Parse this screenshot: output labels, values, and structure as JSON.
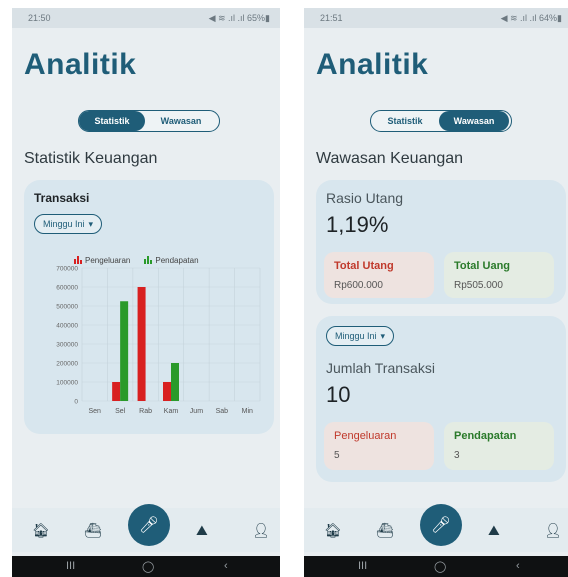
{
  "left": {
    "status": {
      "time": "21:50",
      "icons": "◀ ≋ .ıl .ıl 65%▮"
    },
    "title": "Analitik",
    "tabs": [
      {
        "label": "Statistik",
        "active": true
      },
      {
        "label": "Wawasan",
        "active": false
      }
    ],
    "section_title": "Statistik Keuangan",
    "card": {
      "title": "Transaksi",
      "dropdown": "Minggu Ini"
    },
    "legend": {
      "expense": "Pengeluaran",
      "income": "Pendapatan"
    },
    "chart_data": {
      "type": "bar",
      "categories": [
        "Sen",
        "Sel",
        "Rab",
        "Kam",
        "Jum",
        "Sab",
        "Min"
      ],
      "series": [
        {
          "name": "Pengeluaran",
          "color": "#d82020",
          "values": [
            0,
            100000,
            600000,
            100000,
            0,
            0,
            0
          ]
        },
        {
          "name": "Pendapatan",
          "color": "#2a9a2a",
          "values": [
            0,
            525000,
            0,
            200000,
            0,
            0,
            0
          ]
        }
      ],
      "ylim": [
        0,
        700000
      ],
      "yticks": [
        0,
        100000,
        200000,
        300000,
        400000,
        500000,
        600000,
        700000
      ],
      "grid": true,
      "legend": "top"
    }
  },
  "right": {
    "status": {
      "time": "21:51",
      "icons": "◀ ≋ .ıl .ıl 64%▮"
    },
    "title": "Analitik",
    "tabs": [
      {
        "label": "Statistik",
        "active": false
      },
      {
        "label": "Wawasan",
        "active": true
      }
    ],
    "section_title": "Wawasan Keuangan",
    "ratio": {
      "label": "Rasio Utang",
      "value": "1,19%"
    },
    "debt": {
      "label": "Total Utang",
      "value": "Rp600.000"
    },
    "money": {
      "label": "Total Uang",
      "value": "Rp505.000"
    },
    "dropdown": "Minggu Ini",
    "count": {
      "label": "Jumlah Transaksi",
      "value": "10"
    },
    "expense": {
      "label": "Pengeluaran",
      "value": "5"
    },
    "income": {
      "label": "Pendapatan",
      "value": "3"
    }
  },
  "nav": {
    "icons": [
      "home-icon",
      "ship-icon",
      "mic-icon",
      "chart-icon",
      "profile-icon"
    ]
  },
  "sysbar": {
    "recents": "III",
    "home": "◯",
    "back": "‹"
  },
  "colors": {
    "primary": "#1f5d78",
    "expense": "#d82020",
    "income": "#2a9a2a",
    "card": "#d8e6ee"
  }
}
